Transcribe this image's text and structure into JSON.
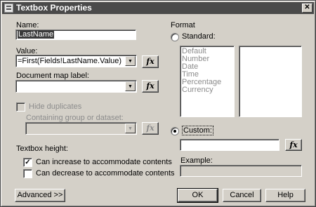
{
  "window": {
    "title": "Textbox Properties",
    "close_glyph": "✕"
  },
  "name": {
    "label": "Name:",
    "value": "LastName"
  },
  "value_field": {
    "label": "Value:",
    "value": "=First(Fields!LastName.Value)",
    "fx_label": "fx"
  },
  "document_map": {
    "label": "Document map label:",
    "value": "",
    "fx_label": "fx"
  },
  "hide_duplicates": {
    "label": "Hide duplicates",
    "checked": false,
    "enabled": false
  },
  "containing_group": {
    "label": "Containing group or dataset:",
    "value": "",
    "fx_label": "fx"
  },
  "textbox_height": {
    "label": "Textbox height:",
    "options": [
      {
        "label": "Can increase to accommodate contents",
        "checked": true,
        "check_glyph": "✓"
      },
      {
        "label": "Can decrease to accommodate contents",
        "checked": false,
        "check_glyph": ""
      }
    ]
  },
  "format": {
    "label": "Format",
    "standard_label": "Standard:",
    "standard_selected": false,
    "standard_items": [
      "Default",
      "Number",
      "Date",
      "Time",
      "Percentage",
      "Currency"
    ],
    "custom_label": "Custom:",
    "custom_selected": true,
    "custom_value": "",
    "fx_label": "fx",
    "example_label": "Example:",
    "example_value": ""
  },
  "buttons": {
    "advanced": "Advanced >>",
    "ok": "OK",
    "cancel": "Cancel",
    "help": "Help"
  },
  "colors": {
    "dialog_bg": "#d4d0c8",
    "titlebar_bg": "#4a4a4a",
    "disabled_text": "#8c8c8c"
  }
}
